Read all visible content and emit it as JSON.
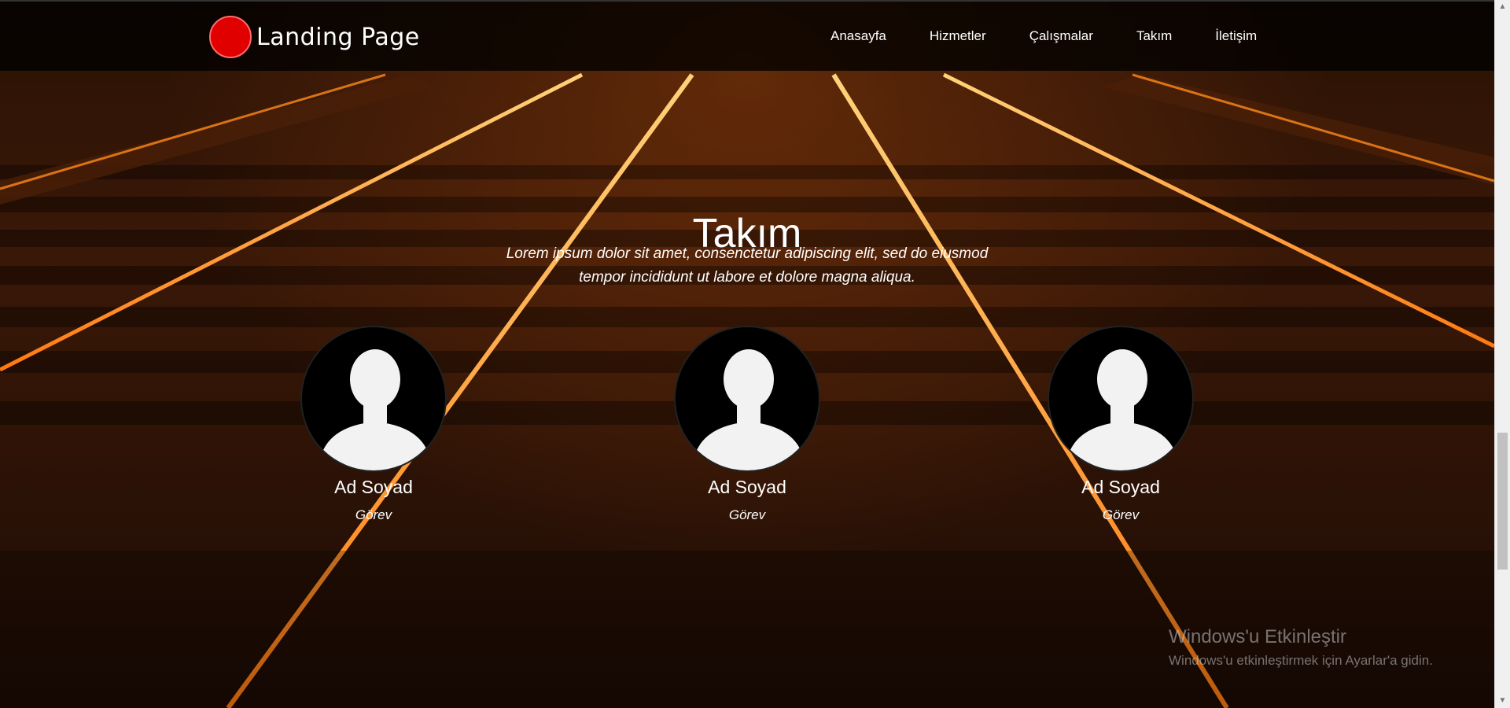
{
  "brand": {
    "name": "Landing Page",
    "logo_color": "#e00000"
  },
  "nav": {
    "items": [
      {
        "label": "Anasayfa"
      },
      {
        "label": "Hizmetler"
      },
      {
        "label": "Çalışmalar"
      },
      {
        "label": "Takım"
      },
      {
        "label": "İletişim"
      }
    ]
  },
  "team": {
    "title": "Takım",
    "subtitle_line1": "Lorem ipsum dolor sit amet, consenctetur adipiscing elit, sed do eiusmod",
    "subtitle_line2": "tempor incididunt ut labore et dolore magna aliqua.",
    "members": [
      {
        "name": "Ad Soyad",
        "role": "Görev",
        "icon": "user-silhouette-icon"
      },
      {
        "name": "Ad Soyad",
        "role": "Görev",
        "icon": "user-silhouette-icon"
      },
      {
        "name": "Ad Soyad",
        "role": "Görev",
        "icon": "user-silhouette-icon"
      }
    ]
  },
  "watermark": {
    "title": "Windows'u Etkinleştir",
    "subtitle": "Windows'u etkinleştirmek için Ayarlar'a gidin."
  },
  "colors": {
    "accent": "#e00000",
    "rail_glow": "#ff8a1a",
    "background": "#2a1206"
  }
}
